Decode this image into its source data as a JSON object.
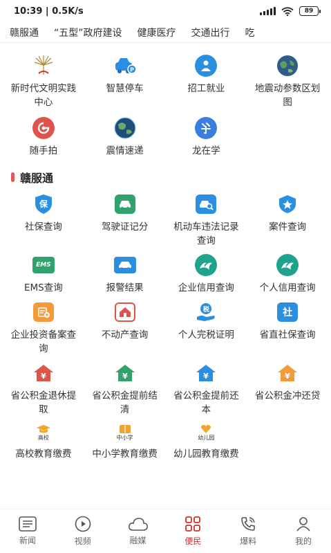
{
  "status": {
    "time": "10:39",
    "speed": "0.5K/s",
    "battery": "89"
  },
  "tabs": [
    "赣服通",
    "“五型”政府建设",
    "健康医疗",
    "交通出行",
    "吃"
  ],
  "top_services": [
    {
      "label": "新时代文明实践中心",
      "icon": "civilization-logo-icon"
    },
    {
      "label": "智慧停车",
      "icon": "parking-car-icon"
    },
    {
      "label": "招工就业",
      "icon": "employment-person-icon"
    },
    {
      "label": "地震动参数区划图",
      "icon": "earth-globe-icon"
    },
    {
      "label": "随手拍",
      "icon": "snapshot-icon"
    },
    {
      "label": "震情速递",
      "icon": "earthquake-globe-icon"
    },
    {
      "label": "龙在学",
      "icon": "study-icon"
    }
  ],
  "section": {
    "title": "赣服通"
  },
  "gan_services": [
    {
      "label": "社保查询",
      "icon": "social-security-shield-icon"
    },
    {
      "label": "驾驶证记分",
      "icon": "driver-license-car-icon"
    },
    {
      "label": "机动车违法记录查询",
      "icon": "vehicle-violation-search-icon"
    },
    {
      "label": "案件查询",
      "icon": "police-badge-icon"
    },
    {
      "label": "EMS查询",
      "icon": "ems-icon",
      "icon_text": "EMS"
    },
    {
      "label": "报警结果",
      "icon": "police-car-icon"
    },
    {
      "label": "企业信用查询",
      "icon": "enterprise-credit-icon"
    },
    {
      "label": "个人信用查询",
      "icon": "personal-credit-icon"
    },
    {
      "label": "企业投资备案查询",
      "icon": "enterprise-investment-icon"
    },
    {
      "label": "不动产查询",
      "icon": "real-estate-house-icon"
    },
    {
      "label": "个人完税证明",
      "icon": "tax-hand-icon",
      "icon_text": "税"
    },
    {
      "label": "省直社保查询",
      "icon": "provincial-social-security-icon",
      "icon_text": "社"
    },
    {
      "label": "省公积金退休提取",
      "icon": "fund-retire-house-icon"
    },
    {
      "label": "省公积金提前结清",
      "icon": "fund-settle-house-icon"
    },
    {
      "label": "省公积金提前还本",
      "icon": "fund-repay-house-icon"
    },
    {
      "label": "省公积金冲还贷",
      "icon": "fund-loan-house-icon"
    },
    {
      "label": "高校教育缴费",
      "icon": "university-cap-icon",
      "icon_text": "高校"
    },
    {
      "label": "中小学教育缴费",
      "icon": "school-book-icon",
      "icon_text": "中小学"
    },
    {
      "label": "幼儿园教育缴费",
      "icon": "kindergarten-icon",
      "icon_text": "幼儿园"
    }
  ],
  "nav": [
    {
      "label": "新闻",
      "icon": "news-icon"
    },
    {
      "label": "视频",
      "icon": "video-play-icon"
    },
    {
      "label": "融媒",
      "icon": "cloud-icon"
    },
    {
      "label": "便民",
      "icon": "grid-apps-icon",
      "active": true
    },
    {
      "label": "爆料",
      "icon": "phone-report-icon"
    },
    {
      "label": "我的",
      "icon": "user-profile-icon"
    }
  ],
  "colors": {
    "accent": "#c9302c",
    "blue": "#2a8fe0",
    "orange": "#f29b38",
    "red": "#e0534a",
    "green": "#2fa36b",
    "teal": "#1fa38c"
  }
}
